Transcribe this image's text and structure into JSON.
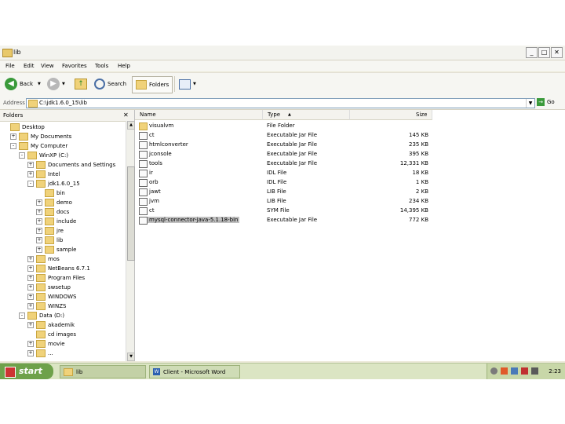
{
  "window": {
    "title": "lib",
    "buttons": {
      "min": "_",
      "max": "□",
      "close": "✕"
    }
  },
  "menu": [
    "File",
    "Edit",
    "View",
    "Favorites",
    "Tools",
    "Help"
  ],
  "toolbar": {
    "back": "Back",
    "search": "Search",
    "folders": "Folders"
  },
  "address": {
    "label": "Address",
    "value": "C:\\jdk1.6.0_15\\lib",
    "go": "Go"
  },
  "folders_pane": {
    "title": "Folders",
    "close": "✕",
    "tree": [
      {
        "label": "Desktop",
        "level": 0,
        "expander": ""
      },
      {
        "label": "My Documents",
        "level": 1,
        "expander": "+"
      },
      {
        "label": "My Computer",
        "level": 1,
        "expander": "-"
      },
      {
        "label": "WinXP (C:)",
        "level": 2,
        "expander": "-"
      },
      {
        "label": "Documents and Settings",
        "level": 3,
        "expander": "+"
      },
      {
        "label": "Intel",
        "level": 3,
        "expander": "+"
      },
      {
        "label": "jdk1.6.0_15",
        "level": 3,
        "expander": "-"
      },
      {
        "label": "bin",
        "level": 4,
        "expander": ""
      },
      {
        "label": "demo",
        "level": 4,
        "expander": "+"
      },
      {
        "label": "docs",
        "level": 4,
        "expander": "+"
      },
      {
        "label": "include",
        "level": 4,
        "expander": "+"
      },
      {
        "label": "jre",
        "level": 4,
        "expander": "+"
      },
      {
        "label": "lib",
        "level": 4,
        "expander": "+"
      },
      {
        "label": "sample",
        "level": 4,
        "expander": "+"
      },
      {
        "label": "mos",
        "level": 3,
        "expander": "+"
      },
      {
        "label": "NetBeans 6.7.1",
        "level": 3,
        "expander": "+"
      },
      {
        "label": "Program Files",
        "level": 3,
        "expander": "+"
      },
      {
        "label": "swsetup",
        "level": 3,
        "expander": "+"
      },
      {
        "label": "WINDOWS",
        "level": 3,
        "expander": "+"
      },
      {
        "label": "WINZS",
        "level": 3,
        "expander": "+"
      },
      {
        "label": "Data (D:)",
        "level": 2,
        "expander": "-"
      },
      {
        "label": "akademik",
        "level": 3,
        "expander": "+"
      },
      {
        "label": "cd images",
        "level": 3,
        "expander": ""
      },
      {
        "label": "movie",
        "level": 3,
        "expander": "+"
      },
      {
        "label": "...",
        "level": 3,
        "expander": "+"
      }
    ]
  },
  "files": {
    "columns": {
      "name": "Name",
      "type": "Type",
      "size": "Size",
      "sort_arrow": "▲"
    },
    "rows": [
      {
        "name": "visualvm",
        "type": "File Folder",
        "size": "",
        "icon": "folder-icon",
        "selected": false
      },
      {
        "name": "ct",
        "type": "Executable Jar File",
        "size": "145 KB",
        "icon": "jar-file-icon",
        "selected": false
      },
      {
        "name": "htmlconverter",
        "type": "Executable Jar File",
        "size": "235 KB",
        "icon": "jar-file-icon",
        "selected": false
      },
      {
        "name": "jconsole",
        "type": "Executable Jar File",
        "size": "395 KB",
        "icon": "jar-file-icon",
        "selected": false
      },
      {
        "name": "tools",
        "type": "Executable Jar File",
        "size": "12,331 KB",
        "icon": "jar-file-icon",
        "selected": false
      },
      {
        "name": "ir",
        "type": "IDL File",
        "size": "18 KB",
        "icon": "idl-file-icon",
        "selected": false
      },
      {
        "name": "orb",
        "type": "IDL File",
        "size": "1 KB",
        "icon": "idl-file-icon",
        "selected": false
      },
      {
        "name": "jawt",
        "type": "LIB File",
        "size": "2 KB",
        "icon": "lib-file-icon",
        "selected": false
      },
      {
        "name": "jvm",
        "type": "LIB File",
        "size": "234 KB",
        "icon": "lib-file-icon",
        "selected": false
      },
      {
        "name": "ct",
        "type": "SYM File",
        "size": "14,395 KB",
        "icon": "sym-file-icon",
        "selected": false
      },
      {
        "name": "mysql-connector-java-5.1.18-bin",
        "type": "Executable Jar File",
        "size": "772 KB",
        "icon": "jar-file-icon",
        "selected": true
      }
    ]
  },
  "taskbar": {
    "start": "start",
    "tasks": [
      {
        "label": "lib",
        "active": true
      },
      {
        "label": "Client - Microsoft Word",
        "active": false
      }
    ],
    "clock": "2:23"
  },
  "colors": {
    "title_bg": "#f3f3ee",
    "chrome": "#f6f6f2",
    "taskbar": "#dbe5c3",
    "start": "#6ea14a",
    "selection": "#c0c0c0"
  }
}
